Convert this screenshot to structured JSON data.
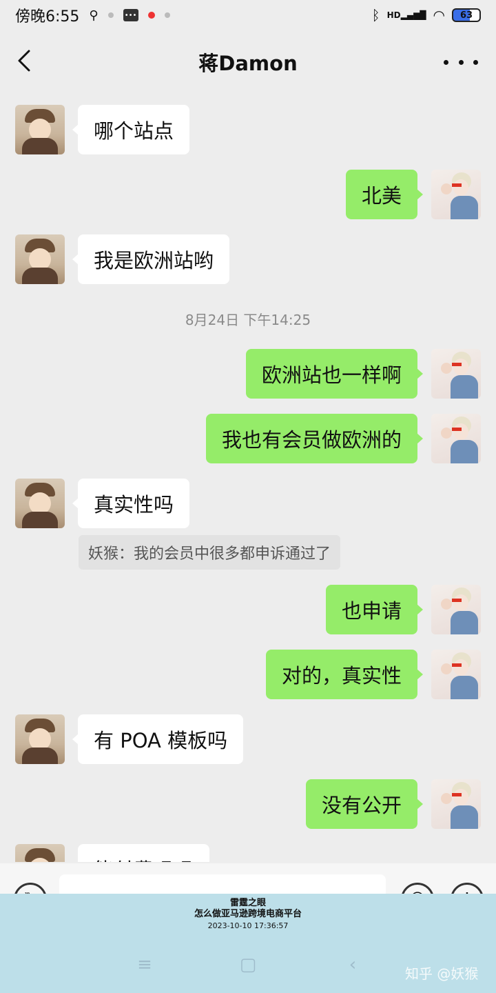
{
  "status_bar": {
    "time": "傍晚6:55",
    "network": "HD",
    "battery": "63"
  },
  "header": {
    "title": "蒋Damon"
  },
  "messages": [
    {
      "side": "in",
      "text": "哪个站点"
    },
    {
      "side": "out",
      "text": "北美"
    },
    {
      "side": "in",
      "text": "我是欧洲站哟"
    },
    {
      "type": "time",
      "text": "8月24日 下午14:25"
    },
    {
      "side": "out",
      "text": "欧洲站也一样啊"
    },
    {
      "side": "out",
      "text": "我也有会员做欧洲的"
    },
    {
      "side": "in",
      "text": "真实性吗",
      "quote": "妖猴：我的会员中很多都申诉通过了"
    },
    {
      "side": "out",
      "text": "也申请"
    },
    {
      "side": "out",
      "text": "对的，真实性"
    },
    {
      "side": "in",
      "text": "有 POA 模板吗"
    },
    {
      "side": "out",
      "text": "没有公开"
    },
    {
      "side": "in",
      "text": "能付费吗吗"
    }
  ],
  "watermark": {
    "line1": "雷霆之眼",
    "line2": "怎么做亚马逊跨境电商平台",
    "line3": "2023-10-10 17:36:57",
    "site": "知乎 @妖猴"
  },
  "icons": [
    "back-icon",
    "more-icon",
    "voice-icon",
    "emoji-icon",
    "plus-icon"
  ]
}
